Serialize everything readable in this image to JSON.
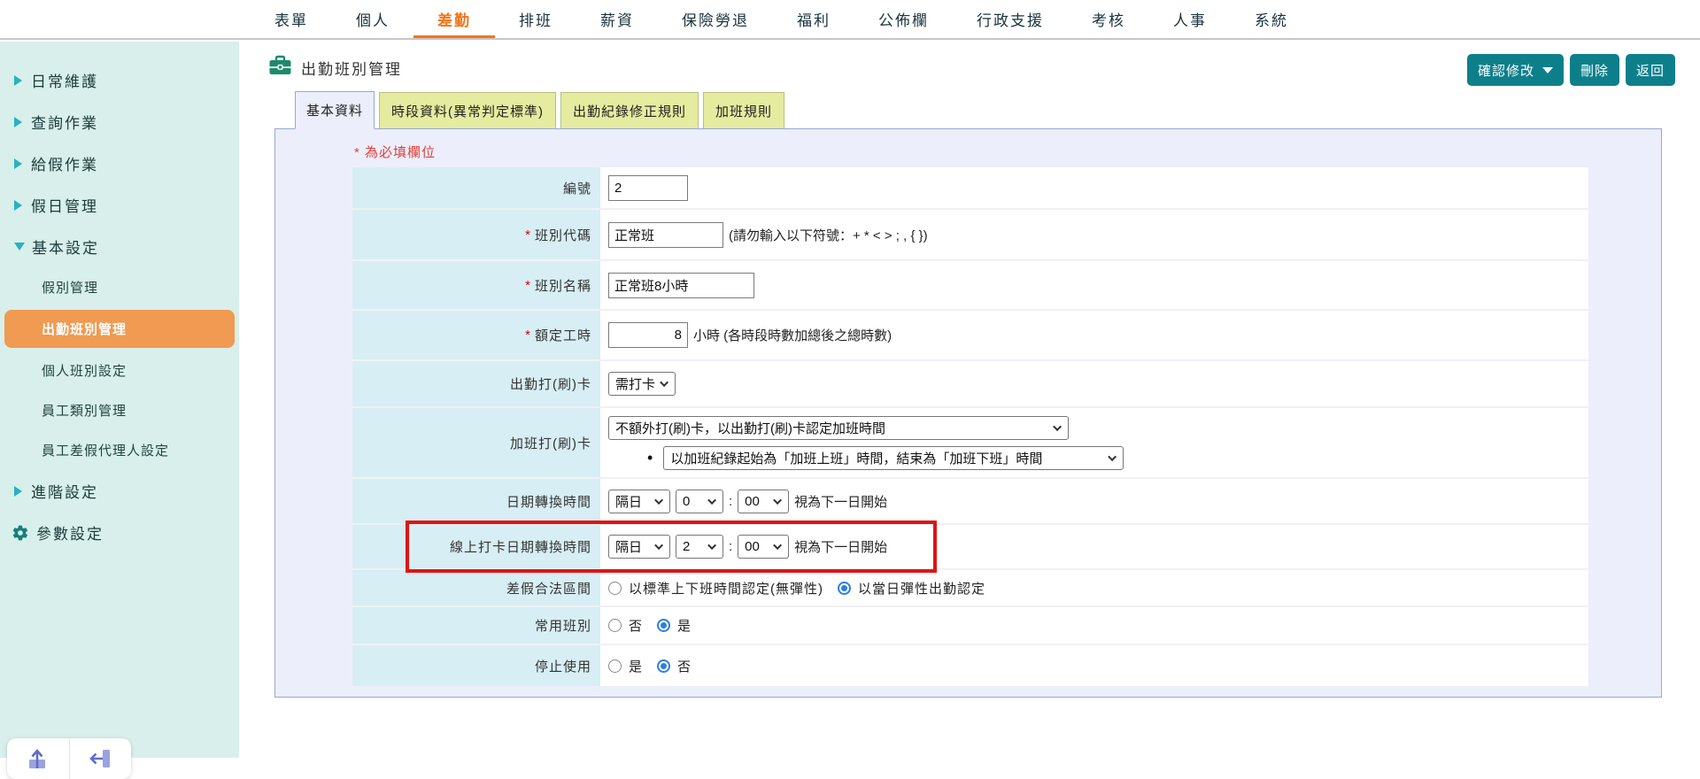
{
  "colors": {
    "accent_orange": "#f0751c",
    "pill_orange": "#f09a52",
    "button_teal": "#0d7f8b",
    "sidebar_mint": "#d9efeb",
    "panel_lavender": "#eceefc",
    "label_cyan": "#d7eef4",
    "tab_inactive": "#e5ec9f",
    "highlight_red": "#e01313",
    "radio_blue": "#2f7de1"
  },
  "nav": {
    "items": [
      "表單",
      "個人",
      "差勤",
      "排班",
      "薪資",
      "保險勞退",
      "福利",
      "公佈欄",
      "行政支援",
      "考核",
      "人事",
      "系統"
    ],
    "active": "差勤"
  },
  "sidebar": {
    "items": [
      "日常維護",
      "查詢作業",
      "給假作業",
      "假日管理",
      "基本設定"
    ],
    "expanded": "基本設定",
    "sub_items": [
      "假別管理",
      "出勤班別管理",
      "個人班別設定",
      "員工類別管理",
      "員工差假代理人設定"
    ],
    "active_sub": "出勤班別管理",
    "bottom_items": [
      "進階設定",
      "參數設定"
    ],
    "icons": [
      "chevron-right-icon",
      "chevron-down-icon",
      "gear-icon"
    ]
  },
  "header": {
    "title": "出勤班別管理",
    "icon": "briefcase-icon",
    "confirm_label": "確認修改",
    "delete_label": "刪除",
    "back_label": "返回"
  },
  "tabs": {
    "items": [
      "基本資料",
      "時段資料(異常判定標準)",
      "出勤紀錄修正規則",
      "加班規則"
    ],
    "active": "基本資料"
  },
  "form": {
    "required_note": "* 為必填欄位",
    "required_mark": "*",
    "rows": {
      "id": {
        "label": "編號",
        "value": "2"
      },
      "code": {
        "label": "班別代碼",
        "value": "正常班",
        "hint": "(請勿輸入以下符號：+ * < > ; , { })"
      },
      "name": {
        "label": "班別名稱",
        "value": "正常班8小時"
      },
      "hours": {
        "label": "額定工時",
        "value": "8",
        "hint": "小時 (各時段時數加總後之總時數)"
      },
      "attendance_punch": {
        "label": "出勤打(刷)卡",
        "value": "需打卡"
      },
      "overtime_punch": {
        "label": "加班打(刷)卡",
        "primary": "不額外打(刷)卡，以出勤打(刷)卡認定加班時間",
        "bullet": "•",
        "secondary": "以加班紀錄起始為「加班上班」時間，結束為「加班下班」時間"
      },
      "date_rollover": {
        "label": "日期轉換時間",
        "day": "隔日",
        "hour": "0",
        "colon": ":",
        "minute": "00",
        "suffix": "視為下一日開始"
      },
      "online_rollover": {
        "label": "線上打卡日期轉換時間",
        "day": "隔日",
        "hour": "2",
        "colon": ":",
        "minute": "00",
        "suffix": "視為下一日開始",
        "highlighted": true
      },
      "leave_interval": {
        "label": "差假合法區間",
        "options": [
          {
            "label": "以標準上下班時間認定(無彈性)",
            "selected": false
          },
          {
            "label": "以當日彈性出勤認定",
            "selected": true
          }
        ]
      },
      "common_shift": {
        "label": "常用班別",
        "options": [
          {
            "label": "否",
            "selected": false
          },
          {
            "label": "是",
            "selected": true
          }
        ]
      },
      "stop_use": {
        "label": "停止使用",
        "options": [
          {
            "label": "是",
            "selected": false
          },
          {
            "label": "否",
            "selected": true
          }
        ]
      }
    }
  },
  "corner_tools": {
    "icons": [
      "upload-icon",
      "collapse-left-icon"
    ]
  }
}
